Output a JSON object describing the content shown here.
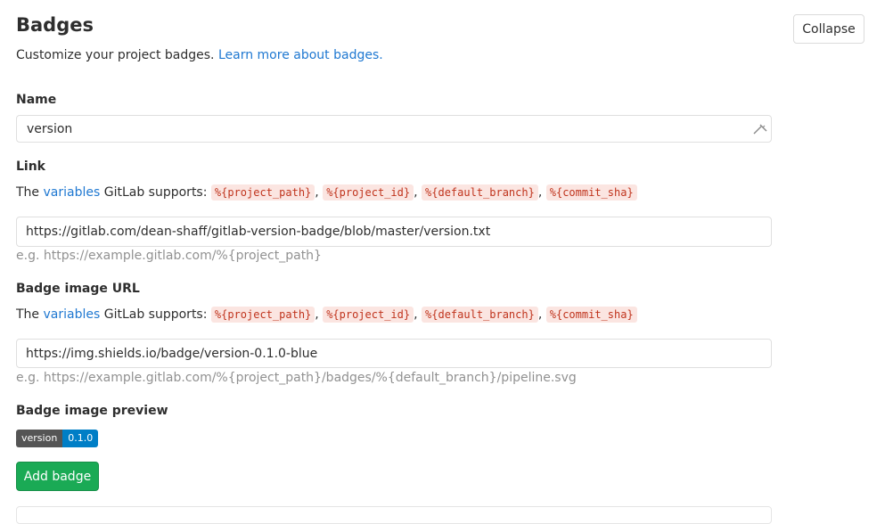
{
  "header": {
    "title": "Badges",
    "collapse_label": "Collapse",
    "subtitle_text": "Customize your project badges.",
    "subtitle_link": "Learn more about badges."
  },
  "name_field": {
    "label": "Name",
    "value": "version"
  },
  "link_field": {
    "label": "Link",
    "help_prefix": "The",
    "help_link": "variables",
    "help_suffix": "GitLab supports:",
    "variables": [
      "%{project_path}",
      "%{project_id}",
      "%{default_branch}",
      "%{commit_sha}"
    ],
    "value": "https://gitlab.com/dean-shaff/gitlab-version-badge/blob/master/version.txt",
    "example": "e.g. https://example.gitlab.com/%{project_path}"
  },
  "image_url_field": {
    "label": "Badge image URL",
    "help_prefix": "The",
    "help_link": "variables",
    "help_suffix": "GitLab supports:",
    "variables": [
      "%{project_path}",
      "%{project_id}",
      "%{default_branch}",
      "%{commit_sha}"
    ],
    "value": "https://img.shields.io/badge/version-0.1.0-blue",
    "example": "e.g. https://example.gitlab.com/%{project_path}/badges/%{default_branch}/pipeline.svg"
  },
  "preview": {
    "label": "Badge image preview",
    "badge_left": "version",
    "badge_right": "0.1.0",
    "badge_left_color": "#555555",
    "badge_right_color": "#007ec6"
  },
  "actions": {
    "add_label": "Add badge",
    "add_color": "#1aaa55"
  },
  "colors": {
    "link": "#1f78d1",
    "code_text": "#c0341d",
    "code_bg": "#fbe5e1"
  }
}
